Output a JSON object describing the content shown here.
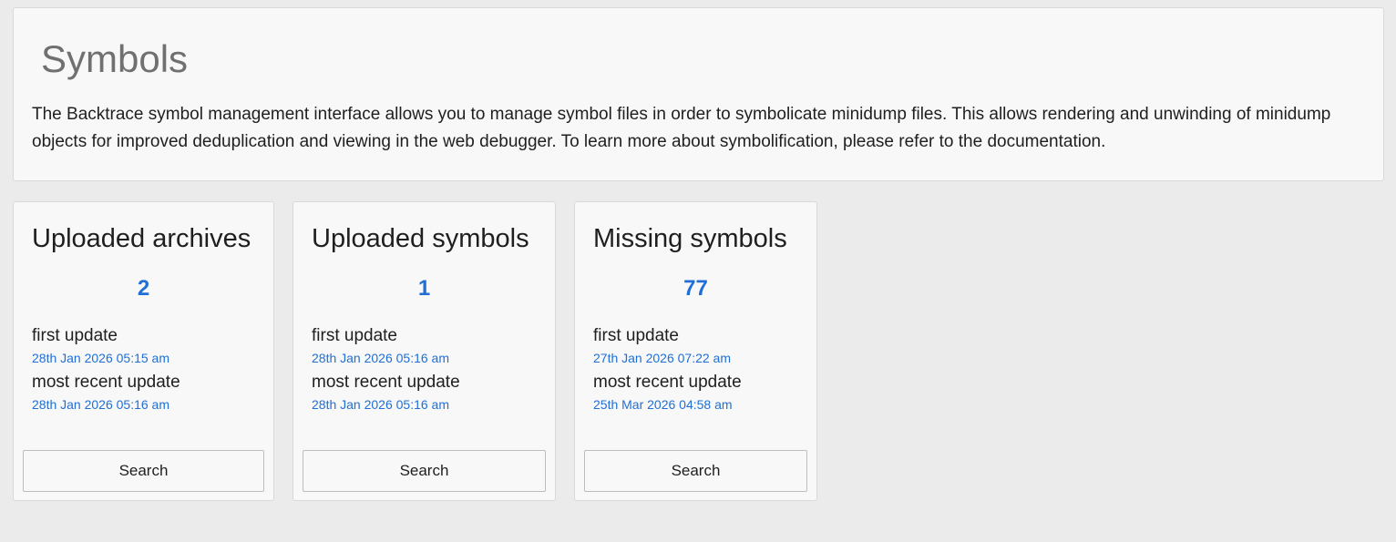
{
  "header": {
    "title": "Symbols",
    "description": "The Backtrace symbol management interface allows you to manage symbol files in order to symbolicate minidump files. This allows rendering and unwinding of minidump objects for improved deduplication and viewing in the web debugger. To learn more about symbolification, please refer to the documentation."
  },
  "cards": [
    {
      "title": "Uploaded archives",
      "count": "2",
      "first_label": "first update",
      "first_date": "28th Jan 2026 05:15 am",
      "recent_label": "most recent update",
      "recent_date": "28th Jan 2026 05:16 am",
      "button": "Search"
    },
    {
      "title": "Uploaded symbols",
      "count": "1",
      "first_label": "first update",
      "first_date": "28th Jan 2026 05:16 am",
      "recent_label": "most recent update",
      "recent_date": "28th Jan 2026 05:16 am",
      "button": "Search"
    },
    {
      "title": "Missing symbols",
      "count": "77",
      "first_label": "first update",
      "first_date": "27th Jan 2026 07:22 am",
      "recent_label": "most recent update",
      "recent_date": "25th Mar 2026 04:58 am",
      "button": "Search"
    }
  ],
  "colors": {
    "accent": "#1f6fd6",
    "background": "#ebebeb",
    "panel": "#f8f8f8"
  }
}
